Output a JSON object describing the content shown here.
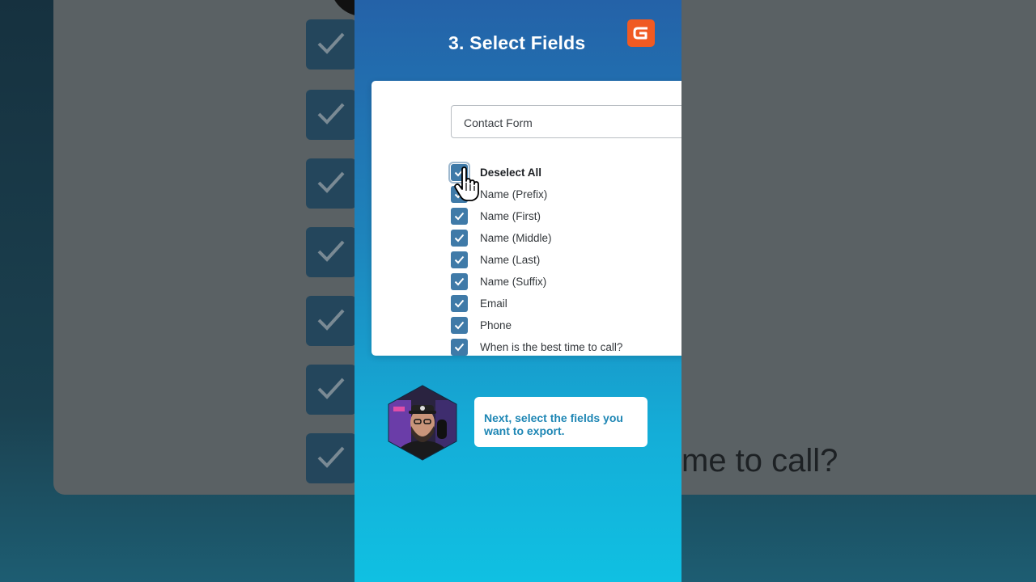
{
  "background": {
    "bg_text": "me to call?",
    "check_rows": 7
  },
  "panel": {
    "title": "3. Select Fields",
    "logo_icon": "gravity-forms-logo-icon"
  },
  "form": {
    "selected_form": "Contact Form"
  },
  "fields": {
    "toggle_all_label": "Deselect All",
    "items": [
      {
        "label": "Name (Prefix)",
        "checked": true
      },
      {
        "label": "Name (First)",
        "checked": true
      },
      {
        "label": "Name (Middle)",
        "checked": true
      },
      {
        "label": "Name (Last)",
        "checked": true
      },
      {
        "label": "Name (Suffix)",
        "checked": true
      },
      {
        "label": "Email",
        "checked": true
      },
      {
        "label": "Phone",
        "checked": true
      },
      {
        "label": "When is the best time to call?",
        "checked": true
      }
    ]
  },
  "presenter": {
    "avatar_icon": "presenter-avatar",
    "message": "Next, select the fields you want to export."
  },
  "colors": {
    "accent_checkbox": "#3f7aa8",
    "brand_orange": "#f05a22",
    "bubble_text": "#1e86b4",
    "panel_top": "#2462a8",
    "panel_bottom": "#10c0e2"
  }
}
